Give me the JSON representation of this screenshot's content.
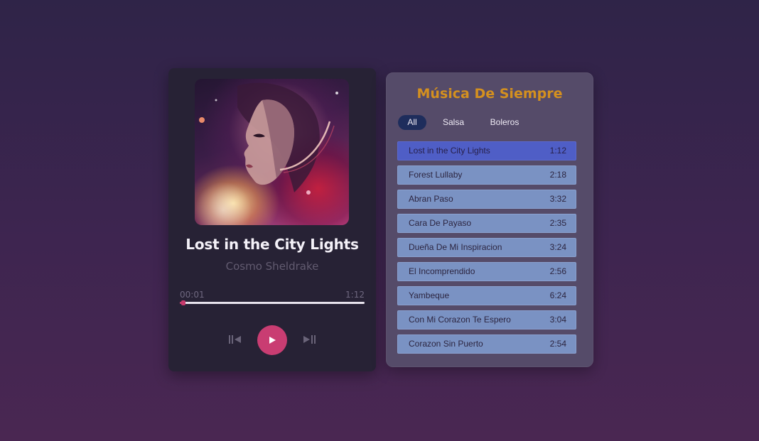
{
  "player": {
    "title": "Lost in the City Lights",
    "artist": "Cosmo Sheldrake",
    "current_time": "00:01",
    "duration": "1:12",
    "progress_fraction": 0.014,
    "accent_color": "#c93d72",
    "cover_art_icon": "album-cover-portrait",
    "controls": {
      "prev_icon": "skip-previous-icon",
      "play_icon": "play-icon",
      "next_icon": "skip-next-icon"
    }
  },
  "playlist": {
    "title": "Música De Siempre",
    "title_color": "#d4901f",
    "tabs": [
      {
        "label": "All",
        "active": true
      },
      {
        "label": "Salsa",
        "active": false
      },
      {
        "label": "Boleros",
        "active": false
      }
    ],
    "songs": [
      {
        "name": "Lost in the City Lights",
        "duration": "1:12",
        "active": true
      },
      {
        "name": "Forest Lullaby",
        "duration": "2:18",
        "active": false
      },
      {
        "name": "Abran Paso",
        "duration": "3:32",
        "active": false
      },
      {
        "name": "Cara De Payaso",
        "duration": "2:35",
        "active": false
      },
      {
        "name": "Dueña De Mi Inspiracion",
        "duration": "3:24",
        "active": false
      },
      {
        "name": "El Incomprendido",
        "duration": "2:56",
        "active": false
      },
      {
        "name": "Yambeque",
        "duration": "6:24",
        "active": false
      },
      {
        "name": "Con Mi Corazon Te Espero",
        "duration": "3:04",
        "active": false
      },
      {
        "name": "Corazon Sin Puerto",
        "duration": "2:54",
        "active": false
      }
    ]
  }
}
